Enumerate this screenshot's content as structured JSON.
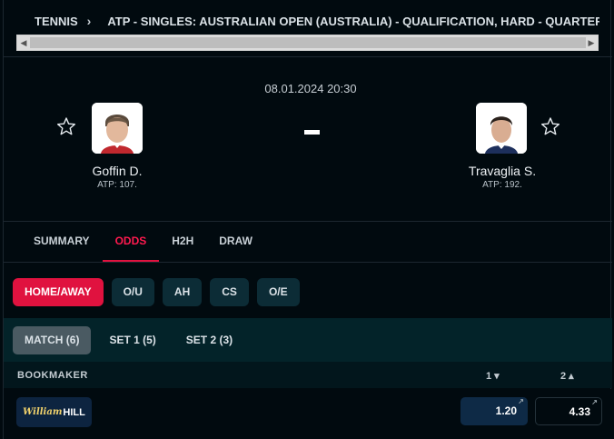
{
  "breadcrumb": {
    "sport": "TENNIS",
    "competition": "ATP - SINGLES: AUSTRALIAN OPEN (AUSTRALIA) - QUALIFICATION, HARD - QUARTER"
  },
  "match": {
    "datetime": "08.01.2024 20:30",
    "score": "-",
    "home": {
      "name": "Goffin D.",
      "rank": "ATP: 107."
    },
    "away": {
      "name": "Travaglia S.",
      "rank": "ATP: 192."
    }
  },
  "tabs": [
    {
      "label": "SUMMARY",
      "active": false
    },
    {
      "label": "ODDS",
      "active": true
    },
    {
      "label": "H2H",
      "active": false
    },
    {
      "label": "DRAW",
      "active": false
    }
  ],
  "odds_types": [
    {
      "label": "HOME/AWAY",
      "active": true
    },
    {
      "label": "O/U",
      "active": false
    },
    {
      "label": "AH",
      "active": false
    },
    {
      "label": "CS",
      "active": false
    },
    {
      "label": "O/E",
      "active": false
    }
  ],
  "periods": [
    {
      "label": "MATCH (6)",
      "active": true
    },
    {
      "label": "SET 1 (5)",
      "active": false
    },
    {
      "label": "SET 2 (3)",
      "active": false
    }
  ],
  "table": {
    "header_bookmaker": "BOOKMAKER",
    "header_col1": "1 ▾",
    "header_col2": "2 ▴",
    "rows": [
      {
        "bookmaker_logo_a": "William",
        "bookmaker_logo_b": "HILL",
        "odd1": "1.20",
        "odd2": "4.33"
      }
    ]
  },
  "colors": {
    "accent": "#e0123f",
    "background": "#010a0f",
    "chip": "#0c2c36"
  }
}
